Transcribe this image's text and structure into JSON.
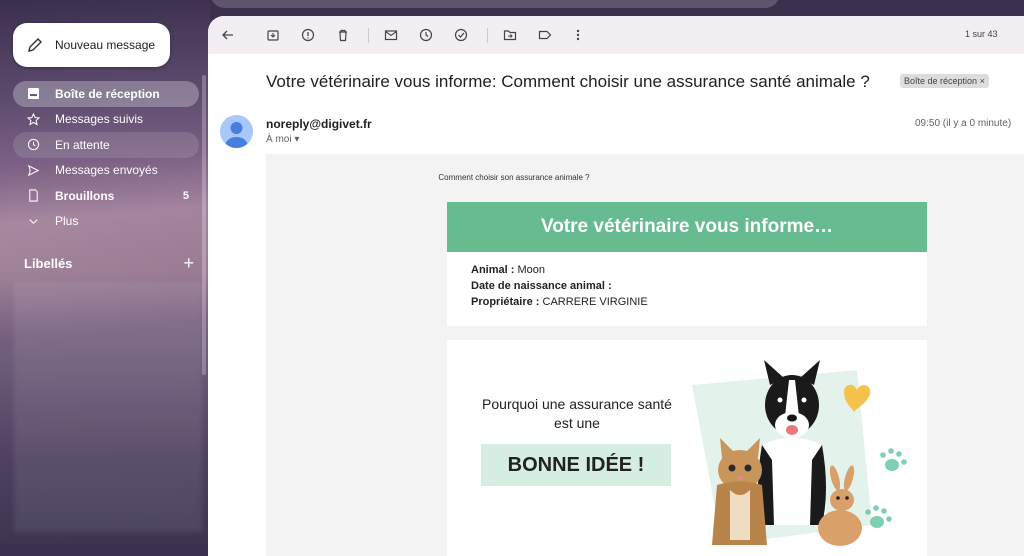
{
  "compose": {
    "label": "Nouveau message"
  },
  "sidebar": {
    "items": [
      {
        "label": "Boîte de réception",
        "count": ""
      },
      {
        "label": "Messages suivis",
        "count": ""
      },
      {
        "label": "En attente",
        "count": ""
      },
      {
        "label": "Messages envoyés",
        "count": ""
      },
      {
        "label": "Brouillons",
        "count": "5"
      },
      {
        "label": "Plus",
        "count": ""
      }
    ],
    "labels_title": "Libellés",
    "labels_add": "+"
  },
  "toolbar": {
    "pager": "1 sur 43"
  },
  "email": {
    "subject": "Votre vétérinaire vous informe: Comment choisir une assurance santé animale ?",
    "badge": "Boîte de réception",
    "badge_close": "×",
    "sender": "noreply@digivet.fr",
    "to": "À moi",
    "time": "09:50 (il y a 0 minute)"
  },
  "content": {
    "preheader": "Comment choisir son assurance animale ?",
    "banner": "Votre vétérinaire vous informe…",
    "animal_label": "Animal :",
    "animal_value": "Moon",
    "dob_label": "Date de naissance animal :",
    "dob_value": "",
    "owner_label": "Propriétaire :",
    "owner_value": "CARRERE VIRGINIE",
    "promo_question": "Pourquoi une assurance santé est une",
    "promo_cta": "BONNE IDÉE !"
  },
  "colors": {
    "accent_green": "#66bb91",
    "cta_bg": "#d6eee1",
    "heart": "#f5c34b",
    "paw": "#7fcfb0"
  }
}
